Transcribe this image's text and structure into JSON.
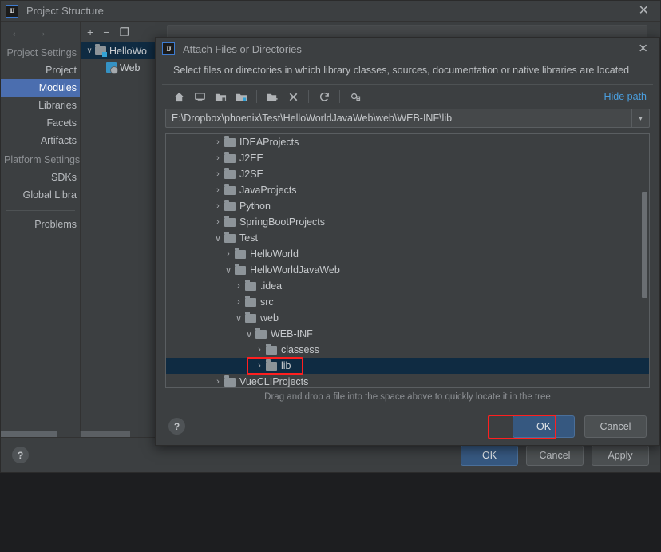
{
  "colors": {
    "accent": "#4b6eaf",
    "selection": "#0f2b42",
    "highlight": "#ff1f1f",
    "link": "#4a9ede",
    "primary_button": "#365880",
    "window_bg": "#3c3f41"
  },
  "project_structure": {
    "title": "Project Structure",
    "close_label": "✕",
    "nav_back_label": "←",
    "nav_forward_label": "→",
    "sidebar": [
      {
        "label": "Project Settings",
        "type": "group"
      },
      {
        "label": "Project",
        "type": "item"
      },
      {
        "label": "Modules",
        "type": "item",
        "selected": true
      },
      {
        "label": "Libraries",
        "type": "item"
      },
      {
        "label": "Facets",
        "type": "item"
      },
      {
        "label": "Artifacts",
        "type": "item"
      },
      {
        "label": "Platform Settings",
        "type": "group"
      },
      {
        "label": "SDKs",
        "type": "item"
      },
      {
        "label": "Global Libra",
        "type": "item"
      },
      {
        "label": "",
        "type": "separator"
      },
      {
        "label": "Problems",
        "type": "item"
      }
    ],
    "modules_toolbar": {
      "add_label": "+",
      "remove_label": "−",
      "copy_label": "❐"
    },
    "modules_tree": [
      {
        "label": "HelloWo",
        "arrow": "∨",
        "icon": "module-folder-icon",
        "selected": true,
        "indent": 0
      },
      {
        "label": "Web",
        "arrow": "",
        "icon": "web-facet-icon",
        "selected": false,
        "indent": 1
      }
    ],
    "footer": {
      "help_label": "?",
      "ok_label": "OK",
      "cancel_label": "Cancel",
      "apply_label": "Apply"
    }
  },
  "attach_dialog": {
    "title": "Attach Files or Directories",
    "close_label": "✕",
    "description": "Select files or directories in which library classes, sources, documentation or native libraries are located",
    "toolbar": [
      {
        "name": "home-icon",
        "glyph": "home"
      },
      {
        "name": "desktop-icon",
        "glyph": "desktop"
      },
      {
        "name": "project-folder-icon",
        "glyph": "folder-small"
      },
      {
        "name": "module-folder-icon",
        "glyph": "folder-badge"
      },
      {
        "name": "new-folder-icon",
        "glyph": "folder-plus"
      },
      {
        "name": "delete-icon",
        "glyph": "x"
      },
      {
        "name": "refresh-icon",
        "glyph": "refresh"
      },
      {
        "name": "show-hidden-icon",
        "glyph": "hidden"
      }
    ],
    "hide_path_label": "Hide path",
    "path_value": "E:\\Dropbox\\phoenix\\Test\\HelloWorldJavaWeb\\web\\WEB-INF\\lib",
    "path_dropdown_label": "▾",
    "tree": [
      {
        "label": "IDEAProjects",
        "arrow": "›",
        "indent": 1,
        "selected": false
      },
      {
        "label": "J2EE",
        "arrow": "›",
        "indent": 1,
        "selected": false
      },
      {
        "label": "J2SE",
        "arrow": "›",
        "indent": 1,
        "selected": false
      },
      {
        "label": "JavaProjects",
        "arrow": "›",
        "indent": 1,
        "selected": false
      },
      {
        "label": "Python",
        "arrow": "›",
        "indent": 1,
        "selected": false
      },
      {
        "label": "SpringBootProjects",
        "arrow": "›",
        "indent": 1,
        "selected": false
      },
      {
        "label": "Test",
        "arrow": "∨",
        "indent": 1,
        "selected": false
      },
      {
        "label": "HelloWorld",
        "arrow": "›",
        "indent": 2,
        "selected": false
      },
      {
        "label": "HelloWorldJavaWeb",
        "arrow": "∨",
        "indent": 2,
        "selected": false
      },
      {
        "label": ".idea",
        "arrow": "›",
        "indent": 3,
        "selected": false
      },
      {
        "label": "src",
        "arrow": "›",
        "indent": 3,
        "selected": false
      },
      {
        "label": "web",
        "arrow": "∨",
        "indent": 3,
        "selected": false
      },
      {
        "label": "WEB-INF",
        "arrow": "∨",
        "indent": 4,
        "selected": false
      },
      {
        "label": "classess",
        "arrow": "›",
        "indent": 5,
        "selected": false
      },
      {
        "label": "lib",
        "arrow": "›",
        "indent": 5,
        "selected": true,
        "highlighted": true
      },
      {
        "label": "VueCLIProjects",
        "arrow": "›",
        "indent": 1,
        "selected": false
      }
    ],
    "hint": "Drag and drop a file into the space above to quickly locate it in the tree",
    "footer": {
      "help_label": "?",
      "ok_label": "OK",
      "ok_highlighted": true,
      "cancel_label": "Cancel"
    }
  }
}
